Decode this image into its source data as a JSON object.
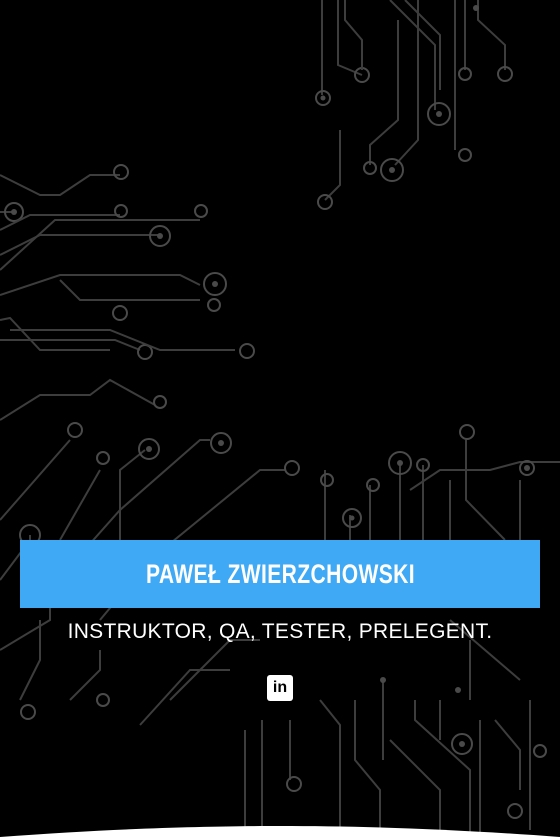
{
  "hero": {
    "name": "PAWEŁ ZWIERZCHOWSKI",
    "subtitle": "INSTRUKTOR, QA, TESTER, PRELEGENT.",
    "accent_color": "#3fa9f5"
  },
  "social": {
    "icon": "linkedin-icon",
    "glyph": "in"
  }
}
